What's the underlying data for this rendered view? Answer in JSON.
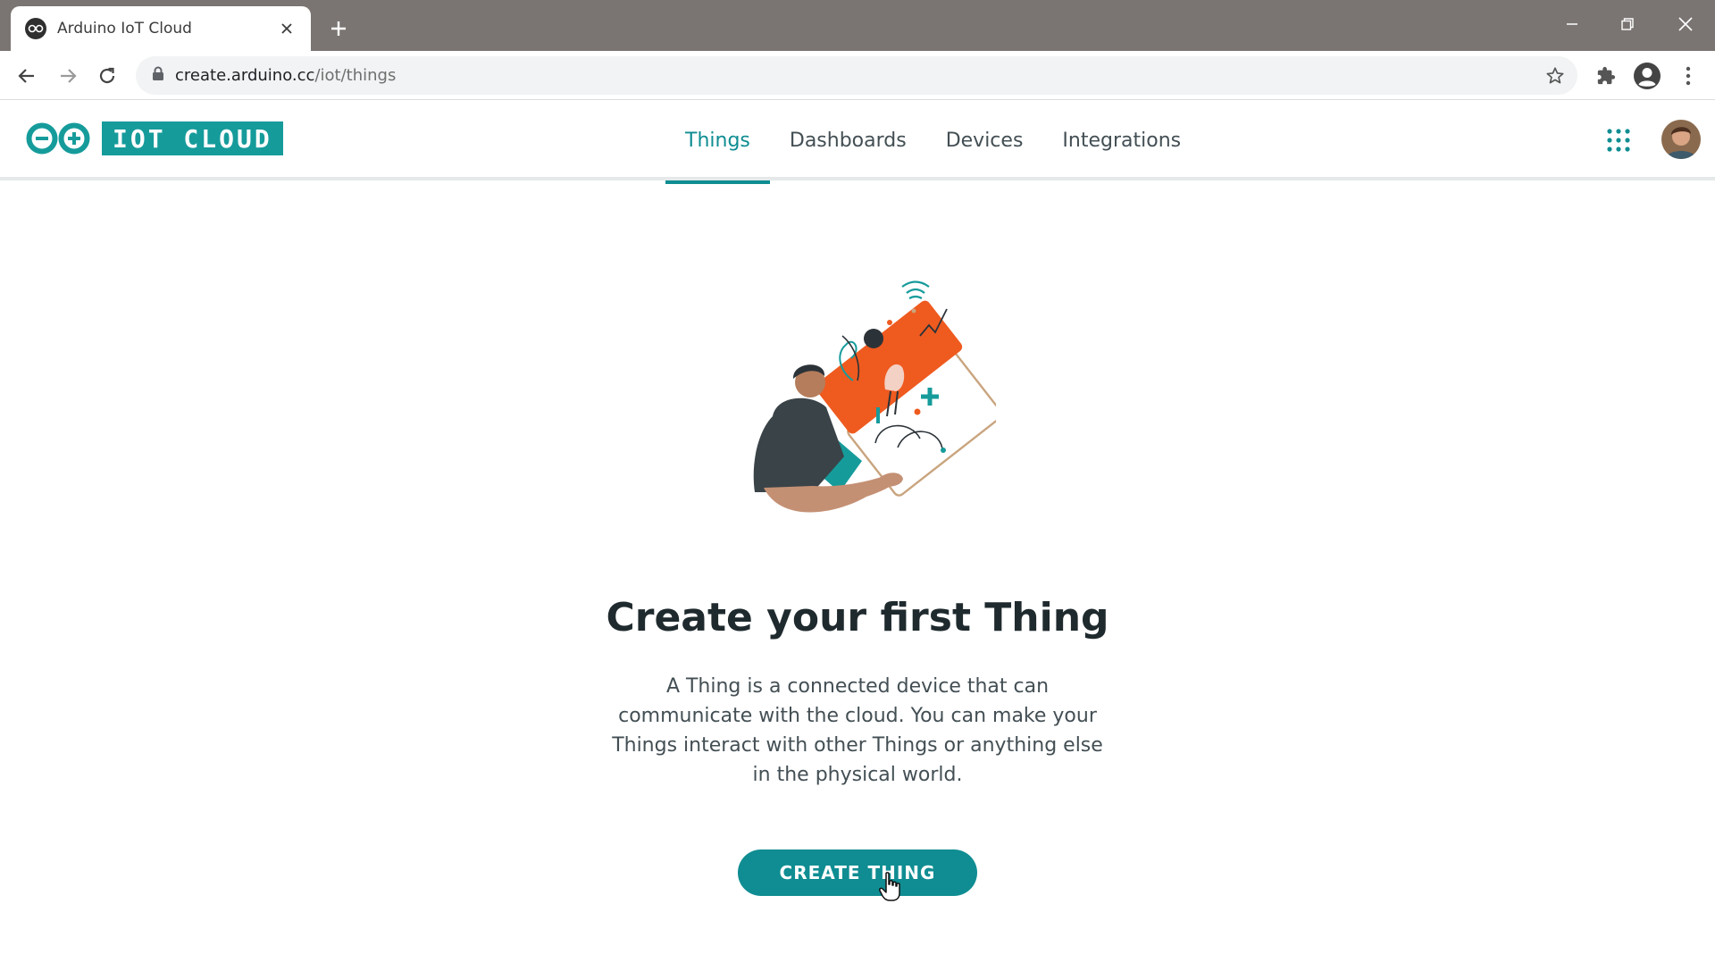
{
  "browser": {
    "tab_title": "Arduino IoT Cloud",
    "url_host": "create.arduino.cc",
    "url_path": "/iot/things"
  },
  "header": {
    "logo_text": "IOT CLOUD",
    "nav": [
      {
        "label": "Things",
        "active": true
      },
      {
        "label": "Dashboards",
        "active": false
      },
      {
        "label": "Devices",
        "active": false
      },
      {
        "label": "Integrations",
        "active": false
      }
    ]
  },
  "empty_state": {
    "title": "Create your first Thing",
    "description": "A Thing is a connected device that can communicate with the cloud. You can make your Things interact with other Things or anything else in the physical world.",
    "button_label": "CREATE THING"
  },
  "colors": {
    "brand_teal": "#0f8d92",
    "logo_teal": "#169b9b",
    "illustration_orange": "#ef5a1f",
    "text_dark": "#1f2a2e",
    "chrome_gray": "#7a7573"
  },
  "icons": [
    "arduino-icon",
    "close-icon",
    "plus-icon",
    "minimize-icon",
    "restore-icon",
    "back-icon",
    "forward-icon",
    "reload-icon",
    "lock-icon",
    "star-icon",
    "extensions-icon",
    "profile-icon",
    "more-icon",
    "apps-grid-icon",
    "cursor-icon"
  ]
}
